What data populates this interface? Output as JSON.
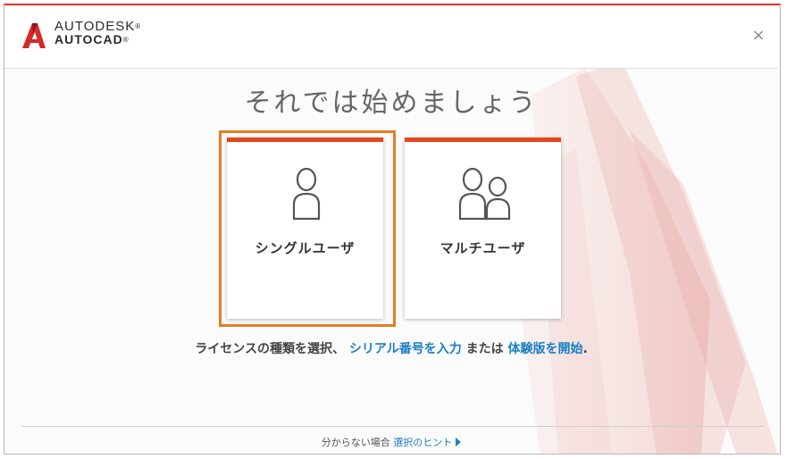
{
  "window": {
    "brand_line1": "AUTODESK",
    "brand_line2": "AUTOCAD",
    "brand_mark": "®",
    "close_glyph": "×"
  },
  "main": {
    "heading": "それでは始めましょう",
    "cards": [
      {
        "label": "シングルユーザ",
        "icon": "single-user-icon",
        "selected": true
      },
      {
        "label": "マルチユーザ",
        "icon": "multi-user-icon",
        "selected": false
      }
    ],
    "options": {
      "text_prefix": "ライセンスの種類を選択、",
      "serial_link": "シリアル番号を入力",
      "text_middle": "または",
      "trial_link": "体験版を開始",
      "text_suffix": "."
    }
  },
  "footer": {
    "text": "分からない場合",
    "link": "選択のヒント"
  },
  "colors": {
    "accent": "#e5461f",
    "selection": "#e67e22",
    "link": "#1a80c4",
    "brand_red": "#e0312a"
  }
}
